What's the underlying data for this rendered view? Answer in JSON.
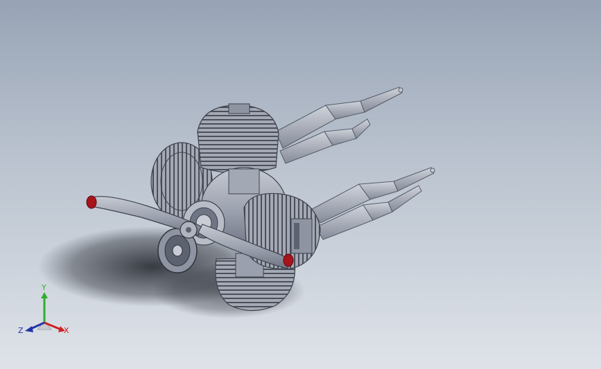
{
  "viewport": {
    "background_top": "#97a3b5",
    "background_bottom": "#dfe3e9",
    "model_color": "#9aa0ad",
    "propeller_tip_color": "#a8141c"
  },
  "triad": {
    "y_label": "Y",
    "x_label": "X",
    "z_label": "Z",
    "y_color": "#2fae2f",
    "x_color": "#cc2222",
    "z_color": "#2233aa"
  }
}
